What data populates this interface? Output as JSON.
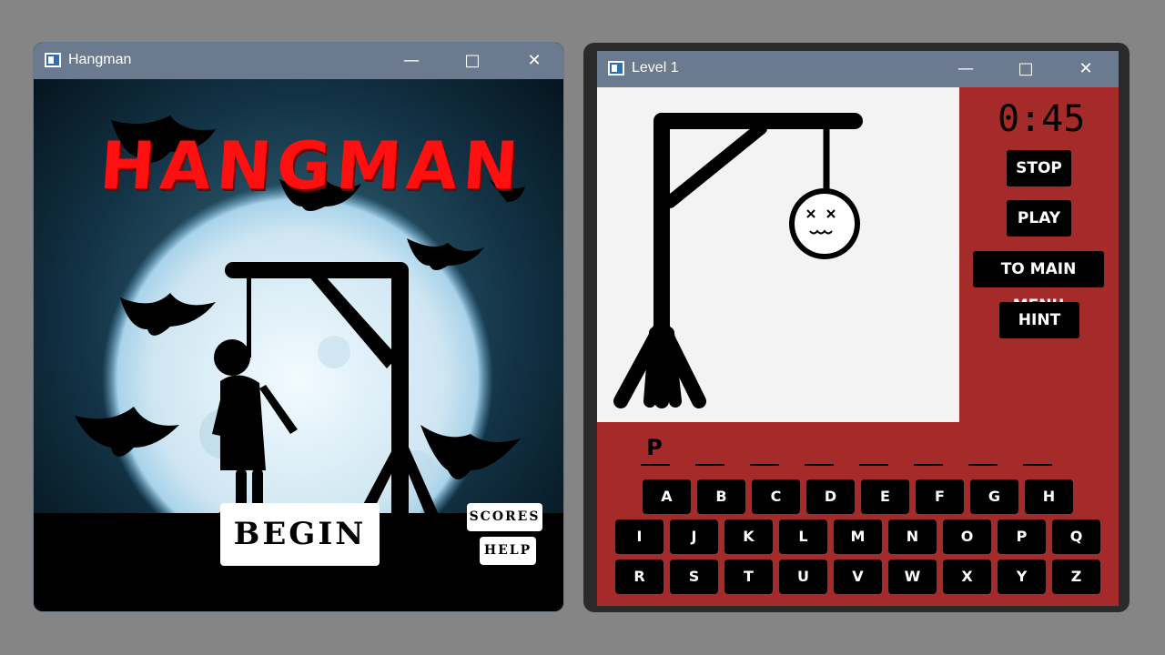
{
  "window_main": {
    "title": "Hangman",
    "logo_text": "HANGMAN",
    "begin_label": "BEGIN",
    "scores_label": "SCORES",
    "help_label": "HELP",
    "icons": [
      "app-icon",
      "minimize-icon",
      "maximize-icon",
      "close-icon"
    ]
  },
  "window_level": {
    "title": "Level 1",
    "timer": "0:45",
    "buttons": {
      "stop": "STOP",
      "play": "PLAY",
      "main_menu": "TO MAIN MENU",
      "hint": "HINT"
    },
    "word": {
      "revealed": "P",
      "slot_count": 8
    },
    "keyboard": {
      "row1": [
        "A",
        "B",
        "C",
        "D",
        "E",
        "F",
        "G",
        "H"
      ],
      "row2": [
        "I",
        "J",
        "K",
        "L",
        "M",
        "N",
        "O",
        "P",
        "Q"
      ],
      "row3": [
        "R",
        "S",
        "T",
        "U",
        "V",
        "W",
        "X",
        "Y",
        "Z"
      ]
    }
  },
  "colors": {
    "desktop": "#858585",
    "titlebar": "#6c7a90",
    "level_bg": "#a52a2a",
    "logo_red": "#ff1010"
  }
}
